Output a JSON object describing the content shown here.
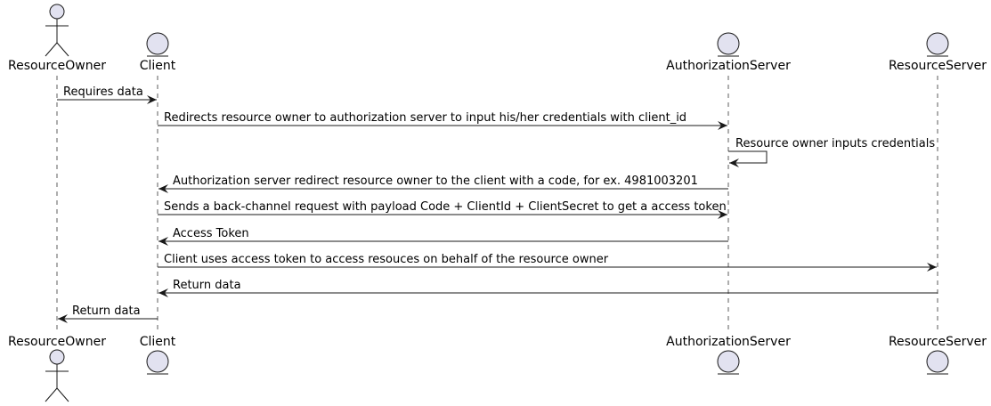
{
  "participants": [
    {
      "id": "ResourceOwner",
      "label": "ResourceOwner",
      "kind": "actor"
    },
    {
      "id": "Client",
      "label": "Client",
      "kind": "entity"
    },
    {
      "id": "AuthorizationServer",
      "label": "AuthorizationServer",
      "kind": "entity"
    },
    {
      "id": "ResourceServer",
      "label": "ResourceServer",
      "kind": "entity"
    }
  ],
  "messages": [
    {
      "from": "ResourceOwner",
      "to": "Client",
      "label": "Requires data"
    },
    {
      "from": "Client",
      "to": "AuthorizationServer",
      "label": "Redirects resource owner to authorization server to input his/her credentials with client_id"
    },
    {
      "from": "AuthorizationServer",
      "to": "AuthorizationServer",
      "label": "Resource owner inputs credentials"
    },
    {
      "from": "AuthorizationServer",
      "to": "Client",
      "label": "Authorization server redirect resource owner to the client with a code, for ex. 4981003201"
    },
    {
      "from": "Client",
      "to": "AuthorizationServer",
      "label": "Sends a back-channel request with payload Code + ClientId + ClientSecret to get a access token"
    },
    {
      "from": "AuthorizationServer",
      "to": "Client",
      "label": "Access Token"
    },
    {
      "from": "Client",
      "to": "ResourceServer",
      "label": "Client uses access token to access resouces on behalf of the resource owner"
    },
    {
      "from": "ResourceServer",
      "to": "Client",
      "label": "Return data"
    },
    {
      "from": "Client",
      "to": "ResourceOwner",
      "label": "Return data"
    }
  ],
  "colors": {
    "participant_fill": "#e2e2f0",
    "participant_stroke": "#181818",
    "lifeline": "#181818",
    "arrow": "#181818"
  },
  "icons": {
    "actor": "stick-figure-icon",
    "entity": "entity-circle-icon"
  }
}
